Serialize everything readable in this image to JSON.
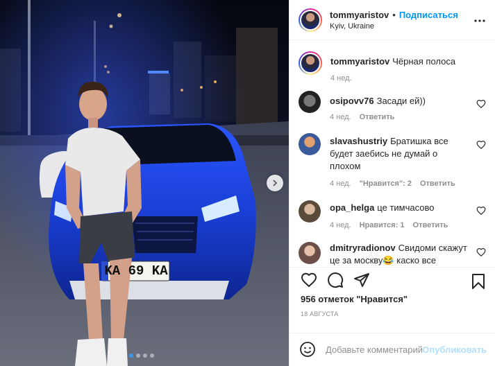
{
  "photo": {
    "plate": "KA 69 KA",
    "next_icon": "chevron-right-icon",
    "slide_count": 4,
    "active_slide": 1
  },
  "header": {
    "username": "tommyaristov",
    "separator": "•",
    "follow_label": "Подписаться",
    "location": "Kyiv, Ukraine",
    "more_icon": "ellipsis-icon"
  },
  "caption": {
    "username": "tommyaristov",
    "text": "Чёрная полоса",
    "time": "4 нед."
  },
  "comments": [
    {
      "username": "osipovv76",
      "text": "Засади ей))",
      "time": "4 нед.",
      "likes": "",
      "reply": "Ответить"
    },
    {
      "username": "slavashustriy",
      "text": "Братишка все будет заебись не думай о плохом",
      "time": "4 нед.",
      "likes": "\"Нравится\": 2",
      "reply": "Ответить"
    },
    {
      "username": "opa_helga",
      "text": "це тимчасово",
      "time": "4 нед.",
      "likes": "Нравится: 1",
      "reply": "Ответить"
    },
    {
      "username": "dmitryradionov",
      "text": "Свидоми скажут це за москву😂 каско все",
      "time": "",
      "likes": "",
      "reply": ""
    }
  ],
  "actions": {
    "like_icon": "heart-icon",
    "comment_icon": "comment-icon",
    "share_icon": "share-icon",
    "save_icon": "bookmark-icon"
  },
  "likes_text": "956 отметок \"Нравится\"",
  "date": "18 АВГУСТА",
  "add_comment": {
    "placeholder": "Добавьте комментарий...",
    "publish_label": "Опубликовать",
    "emoji_icon": "emoji-icon"
  },
  "colors": {
    "accent": "#0095f6",
    "publish_disabled": "#b2dffc",
    "muted": "#8e8e8e",
    "text": "#262626",
    "car_blue": "#1a3fd6"
  }
}
